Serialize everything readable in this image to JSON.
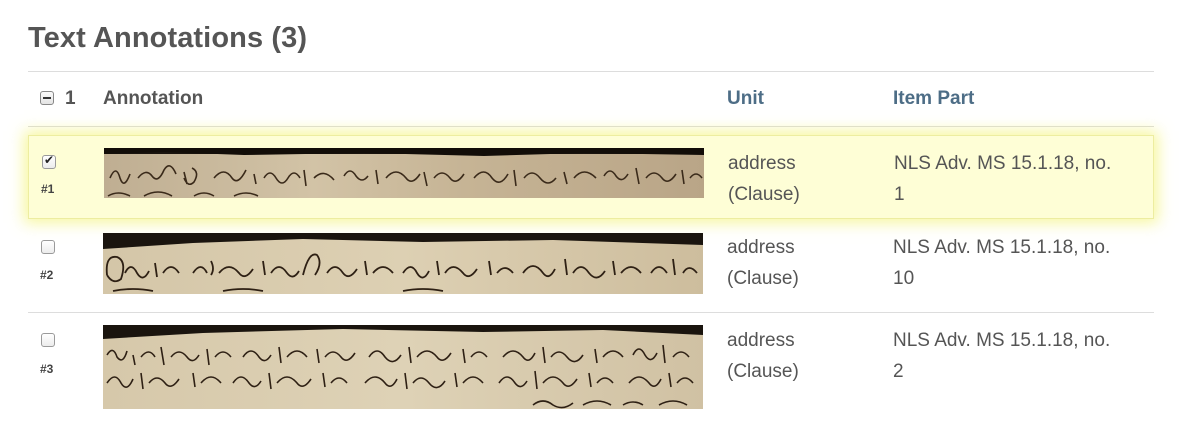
{
  "page": {
    "title": "Text Annotations (3)"
  },
  "table": {
    "header": {
      "select_count": "1",
      "annotation": "Annotation",
      "unit": "Unit",
      "item_part": "Item Part"
    },
    "rows": [
      {
        "checked": true,
        "number": "#1",
        "unit": "address",
        "unit_type": "(Clause)",
        "part_line1": "NLS Adv. MS 15.1.18, no.",
        "part_line2": "1"
      },
      {
        "checked": false,
        "number": "#2",
        "unit": "address",
        "unit_type": "(Clause)",
        "part_line1": "NLS Adv. MS 15.1.18, no.",
        "part_line2": "10"
      },
      {
        "checked": false,
        "number": "#3",
        "unit": "address",
        "unit_type": "(Clause)",
        "part_line1": "NLS Adv. MS 15.1.18, no.",
        "part_line2": "2"
      }
    ]
  },
  "colors": {
    "highlight": "#fefed6",
    "link": "#4d6d86",
    "parchment": "#c9b89a",
    "ink": "#3a2a1a"
  }
}
